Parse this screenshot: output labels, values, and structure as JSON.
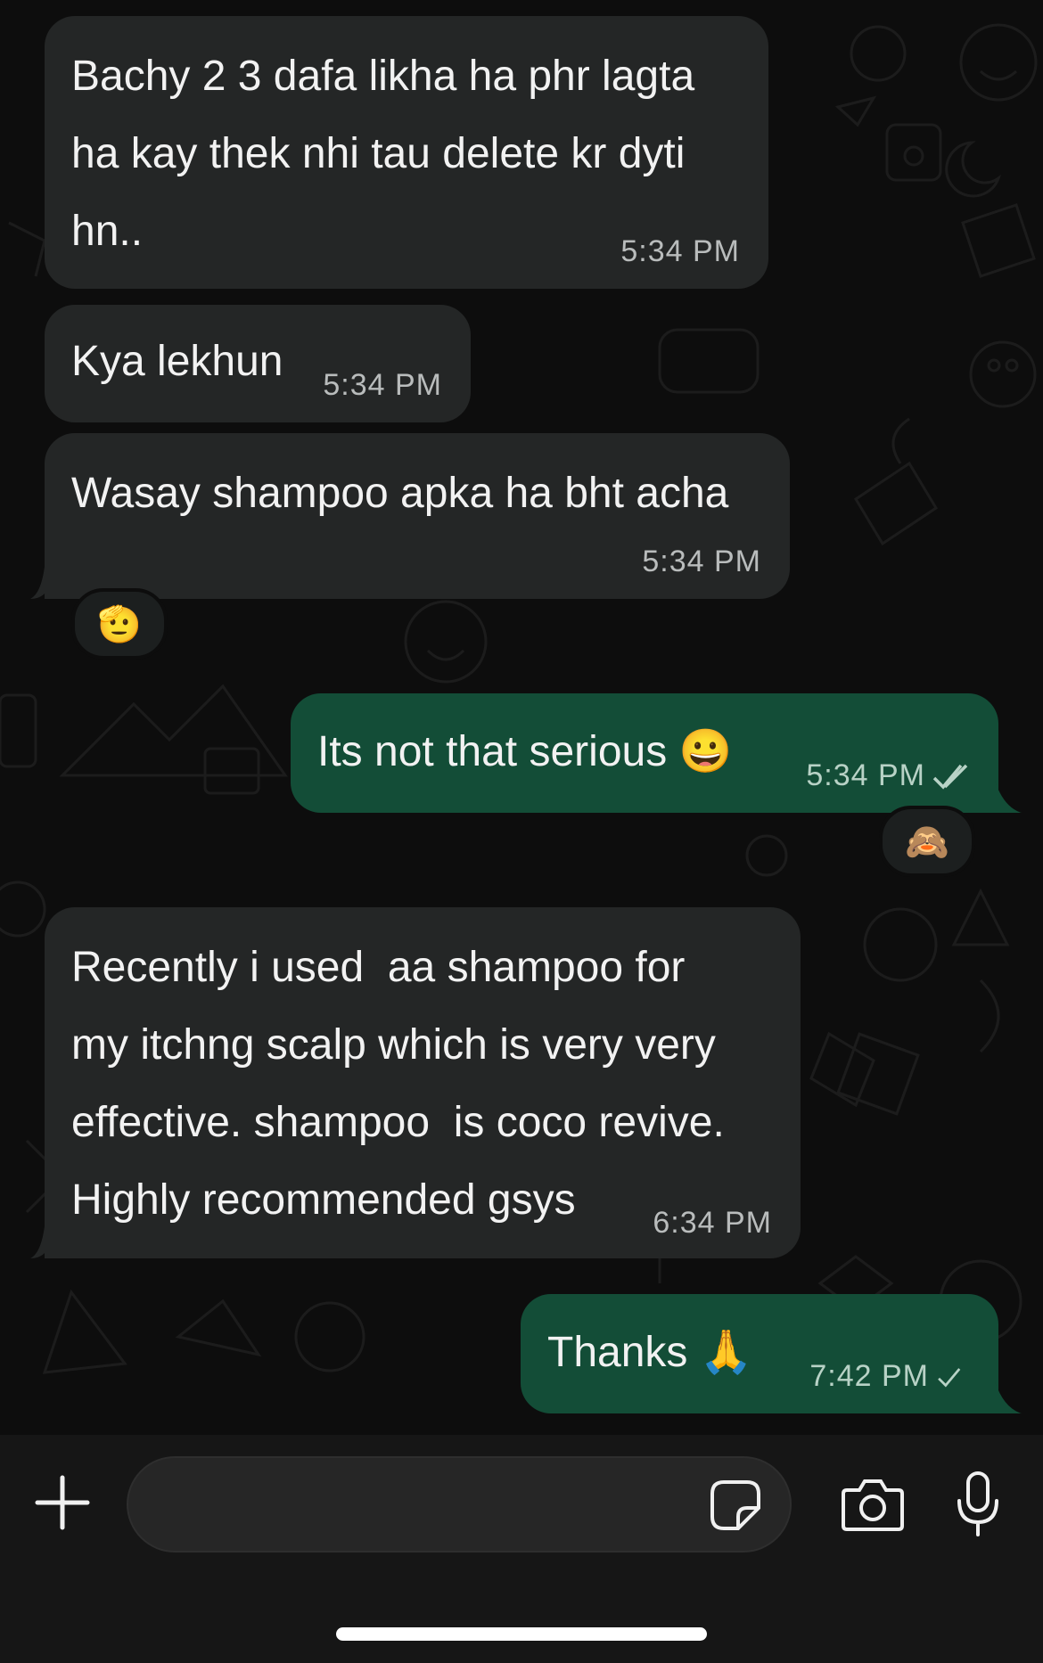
{
  "messages": [
    {
      "direction": "incoming",
      "text": "Bachy 2 3 dafa likha ha phr lagta\nha kay thek nhi tau delete kr dyti\nhn..",
      "time": "5:34 PM"
    },
    {
      "direction": "incoming",
      "text": "Kya lekhun",
      "time": "5:34 PM"
    },
    {
      "direction": "incoming",
      "text": "Wasay shampoo apka ha bht acha",
      "time": "5:34 PM",
      "reaction": "🫡"
    },
    {
      "direction": "outgoing",
      "text": "Its not that serious 😀",
      "time": "5:34 PM",
      "status": "read-double-check",
      "reaction": "🙈"
    },
    {
      "direction": "incoming",
      "text": "Recently i used  aa shampoo for\nmy itchng scalp which is very very\neffective. shampoo  is coco revive.\nHighly recommended gsys",
      "time": "6:34 PM"
    },
    {
      "direction": "outgoing",
      "text": "Thanks 🙏",
      "time": "7:42 PM",
      "status": "sent-single-check"
    }
  ],
  "composer": {
    "input_value": "",
    "icons": [
      "plus-icon",
      "sticker-icon",
      "camera-icon",
      "microphone-icon"
    ]
  },
  "colors": {
    "incoming_bubble": "#242626",
    "outgoing_bubble": "#134d37",
    "background": "#0d0d0d",
    "read_ticks": "#b8d2c6"
  }
}
